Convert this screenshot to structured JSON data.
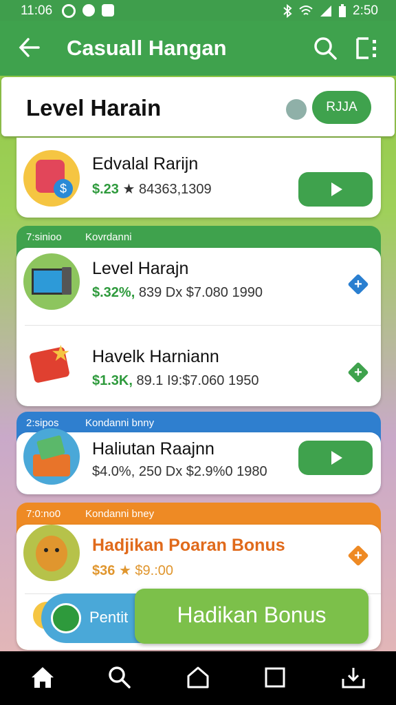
{
  "status": {
    "time_left": "11:06",
    "time_right": "2:50"
  },
  "appbar": {
    "back_icon": "arrow-left-icon",
    "title": "Casuall Hangan"
  },
  "header": {
    "title": "Level Harain",
    "button": "RJJA"
  },
  "colors": {
    "primary": "#3fa24d",
    "blue_header": "#2f7fcf",
    "orange_header": "#ee8a24",
    "bonus": "#7cc04a"
  },
  "top_card": {
    "title": "Edvalal Rarijn",
    "price": "$.23",
    "detail": "★ 84363,1309"
  },
  "groups": [
    {
      "label_left": "7:sinioo",
      "label_right": "Kovrdanni",
      "rows": [
        {
          "title": "Level Harajn",
          "price": "$.32%,",
          "detail": "839 Dx  $7.080 1990"
        },
        {
          "title": "Havelk Harniann",
          "price": "$1.3K,",
          "detail": "89.1 I9:$7.060 1950"
        }
      ]
    },
    {
      "label_left": "2:sipos",
      "label_right": "Kondanni bnny",
      "rows": [
        {
          "title": "Haliutan Raajnn",
          "price": "$4.0%,",
          "detail": "250 Dx  $2.9%0 1980"
        }
      ]
    },
    {
      "label_left": "7:0:no0",
      "label_right": "Kondanni bney",
      "rows": [
        {
          "title": "Hadjikan Poaran Bonus",
          "price": "$36",
          "detail": "★ $9.:00"
        }
      ]
    }
  ],
  "bonus": {
    "left_label": "Pentit",
    "right_label": "Hadikan Bonus"
  },
  "nav": [
    "home-icon",
    "search-icon",
    "house-outline-icon",
    "square-icon",
    "download-icon"
  ]
}
